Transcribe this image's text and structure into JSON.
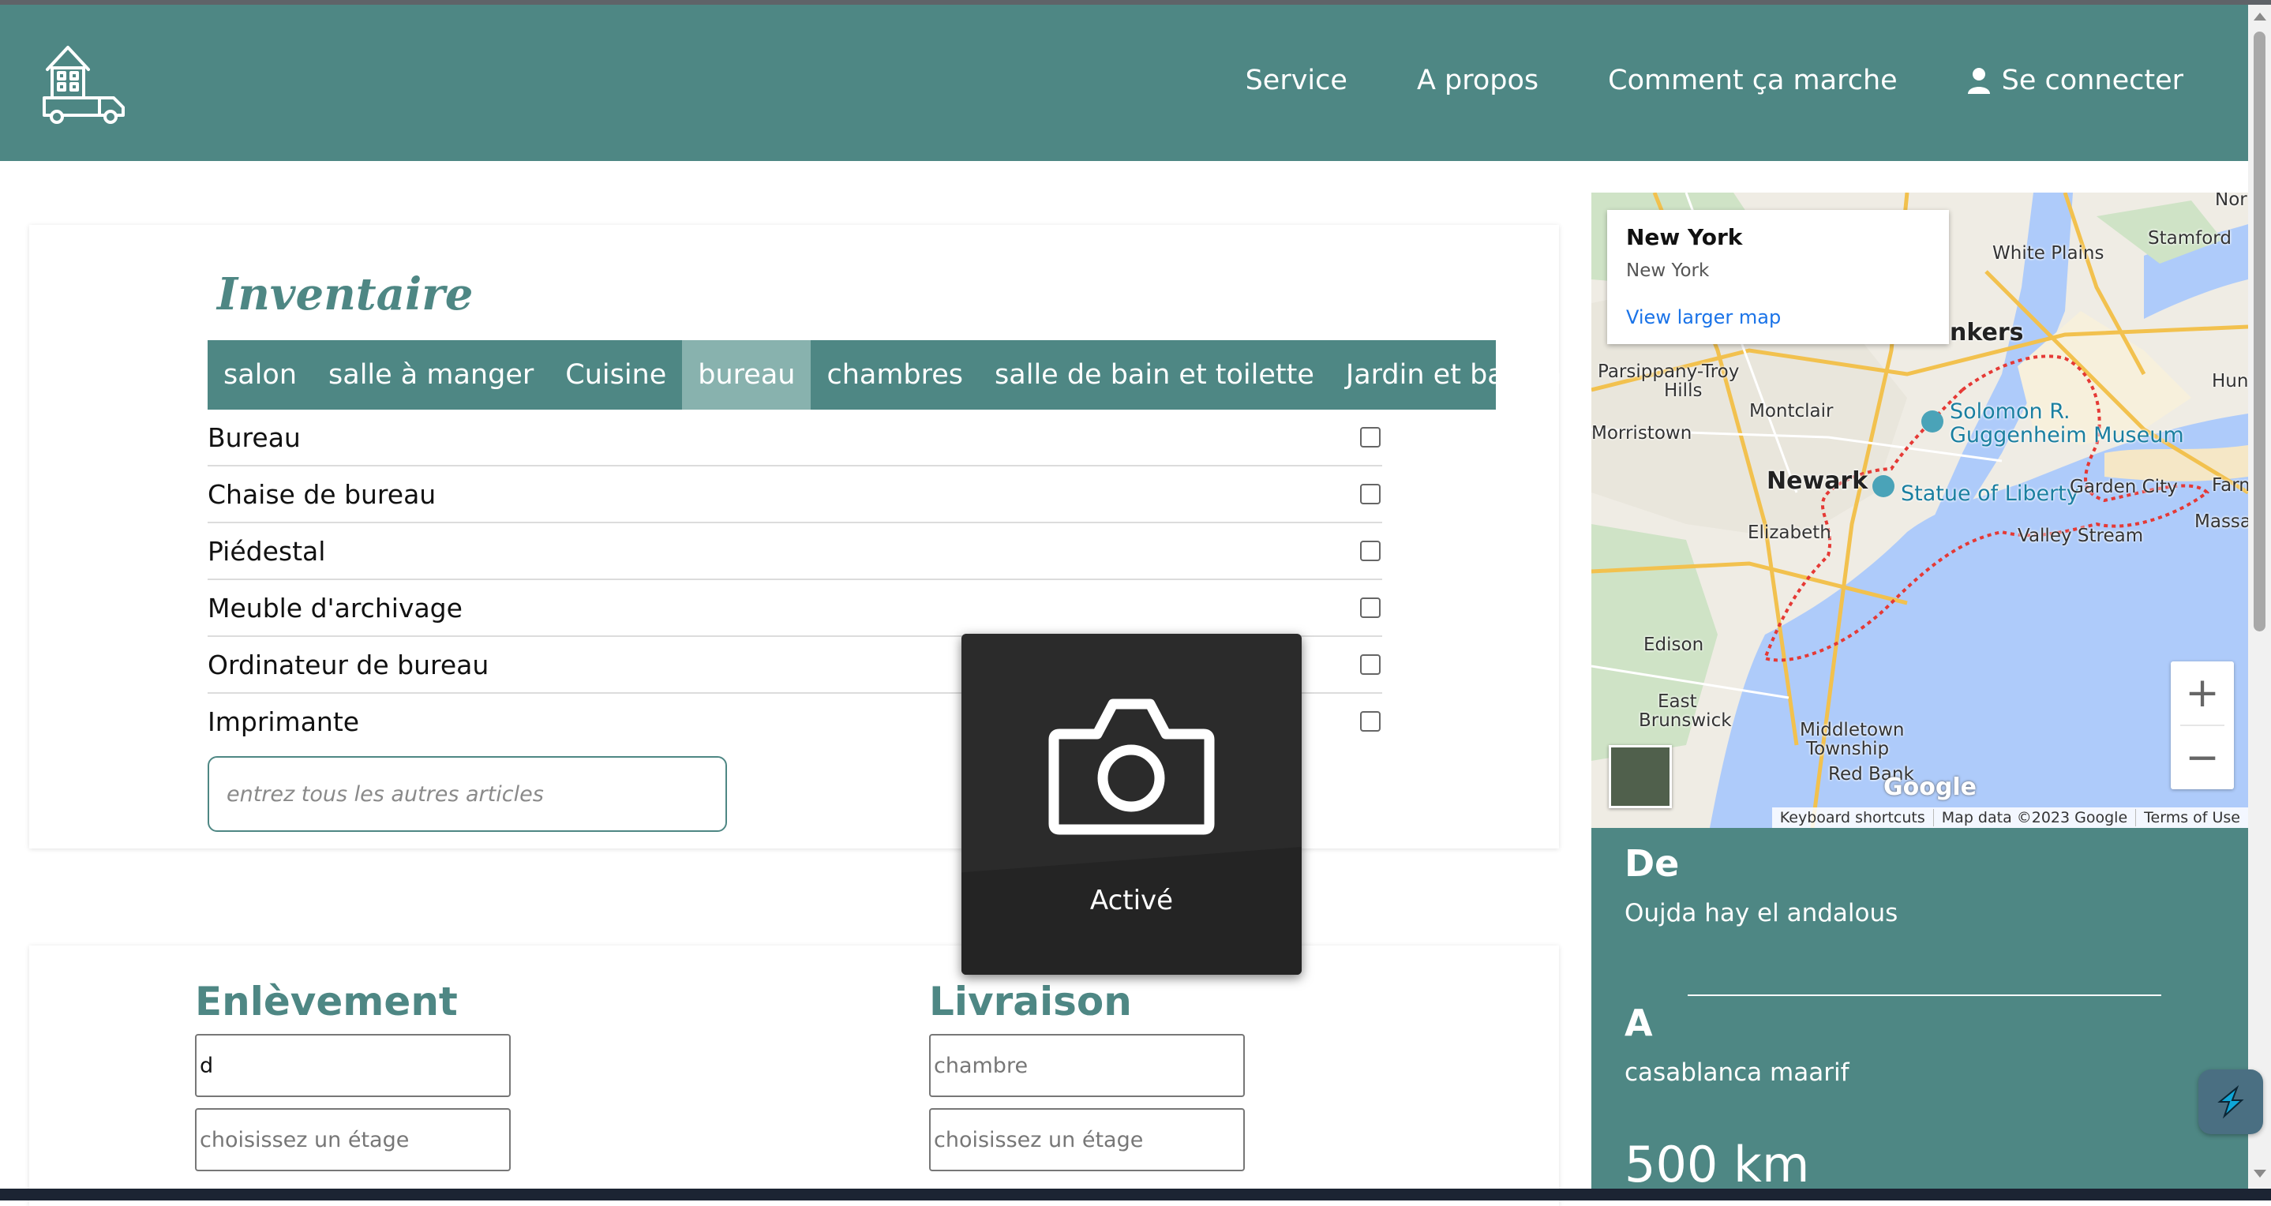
{
  "header": {
    "nav": [
      "Service",
      "A propos",
      "Comment ça marche"
    ],
    "login": "Se connecter"
  },
  "inventory": {
    "title": "Inventaire",
    "tabs": [
      {
        "label": "salon",
        "active": false
      },
      {
        "label": "salle à manger",
        "active": false
      },
      {
        "label": "Cuisine",
        "active": false
      },
      {
        "label": "bureau",
        "active": true
      },
      {
        "label": "chambres",
        "active": false
      },
      {
        "label": "salle de bain et toilette",
        "active": false
      },
      {
        "label": "Jardin et balcon",
        "active": false
      }
    ],
    "items": [
      "Bureau",
      "Chaise de bureau",
      "Piédestal",
      "Meuble d'archivage",
      "Ordinateur de bureau",
      "Imprimante"
    ],
    "other_placeholder": "entrez tous les autres articles"
  },
  "pickup": {
    "title": "Enlèvement",
    "room_value": "d",
    "floor_placeholder": "choisissez un étage"
  },
  "delivery": {
    "title": "Livraison",
    "room_placeholder": "chambre",
    "floor_placeholder": "choisissez un étage"
  },
  "map": {
    "popup_title": "New York",
    "popup_subtitle": "New York",
    "popup_link": "View larger map",
    "zoom_in": "+",
    "zoom_out": "−",
    "keyboard": "Keyboard shortcuts",
    "mapdata": "Map data ©2023 Google",
    "terms": "Terms of Use",
    "google": "Google",
    "places": {
      "stamford": "Stamford",
      "white_plains": "White Plains",
      "yonkers": "nkers",
      "huntington": "Huntin",
      "parsippany": "Parsippany-Troy",
      "hills": "Hills",
      "montclair": "Montclair",
      "morristown": "Morristown",
      "guggenheim_1": "Solomon R.",
      "guggenheim_2": "Guggenheim Museum",
      "newark": "Newark",
      "statue": "Statue of Liberty",
      "garden_city": "Garden City",
      "farmingdale": "Farming",
      "massapequa": "Massapeq",
      "elizabeth": "Elizabeth",
      "valley_stream": "Valley Stream",
      "edison": "Edison",
      "east_brunswick_1": "East",
      "east_brunswick_2": "Brunswick",
      "middletown_1": "Middletown",
      "middletown_2": "Township",
      "red_bank": "Red Bank"
    }
  },
  "summary": {
    "from_label": "De",
    "from_value": "Oujda hay el andalous",
    "to_label": "A",
    "to_value": "casablanca maarif",
    "distance": "500 km"
  },
  "camera_overlay": {
    "status": "Activé"
  },
  "colors": {
    "brand": "#4e8784",
    "tab_active": "#88b2ae",
    "overlay": "#2b2b2b",
    "map_water": "#aecbfa",
    "map_route": "#e53935"
  }
}
